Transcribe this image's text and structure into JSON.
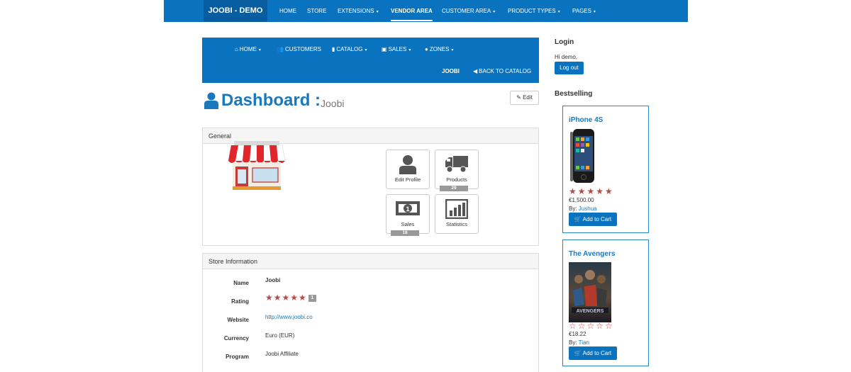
{
  "topnav": {
    "brand": "JOOBI - DEMO",
    "items": [
      {
        "label": "HOME",
        "caret": ""
      },
      {
        "label": "STORE",
        "caret": ""
      },
      {
        "label": "EXTENSIONS",
        "caret": "▾"
      },
      {
        "label": "VENDOR AREA",
        "caret": ""
      },
      {
        "label": "CUSTOMER AREA",
        "caret": "▾"
      },
      {
        "label": "PRODUCT TYPES",
        "caret": "▾"
      },
      {
        "label": "PAGES",
        "caret": "▾"
      }
    ],
    "active": "VENDOR AREA"
  },
  "vendornav": {
    "home": "HOME",
    "customers": "CUSTOMERS",
    "catalog": "CATALOG",
    "sales": "SALES",
    "zones": "ZONES",
    "joobi": "JOOBI",
    "back": "BACK TO CATALOG"
  },
  "dashboard": {
    "title": "Dashboard :",
    "subtitle": "Joobi",
    "edit_label": "Edit"
  },
  "general": {
    "heading": "General",
    "tiles": [
      {
        "label": "Edit Profile",
        "count": ""
      },
      {
        "label": "Products",
        "count": "29"
      },
      {
        "label": "Sales",
        "count": "18"
      },
      {
        "label": "Statistics",
        "count": ""
      }
    ]
  },
  "store_info": {
    "heading": "Store Information",
    "rows": [
      {
        "label": "Name",
        "value": "Joobi"
      },
      {
        "label": "Rating",
        "value": "",
        "badge": "1"
      },
      {
        "label": "Website",
        "value": "http://www.joobi.co"
      },
      {
        "label": "Currency",
        "value": "Euro (EUR)"
      },
      {
        "label": "Program",
        "value": "Joobi Affiliate"
      }
    ],
    "rating_stars": 5
  },
  "login": {
    "heading": "Login",
    "greeting": "Hi demo,",
    "logout_label": "Log out"
  },
  "bestselling": {
    "heading": "Bestselling",
    "products": [
      {
        "name": "iPhone 4S",
        "rating": 5,
        "price": "€1,500.00",
        "by_label": "By:",
        "seller": "Jushua",
        "cart_label": "Add to Cart"
      },
      {
        "name": "The Avengers",
        "rating": 0,
        "price": "€18.22",
        "by_label": "By:",
        "seller": "Tian",
        "cart_label": "Add to Cart"
      }
    ]
  },
  "colors": {
    "primary": "#0a73c0",
    "brand_bg": "#075d9f",
    "link": "#1a78bd",
    "star": "#b94a48",
    "badge": "#999999"
  }
}
